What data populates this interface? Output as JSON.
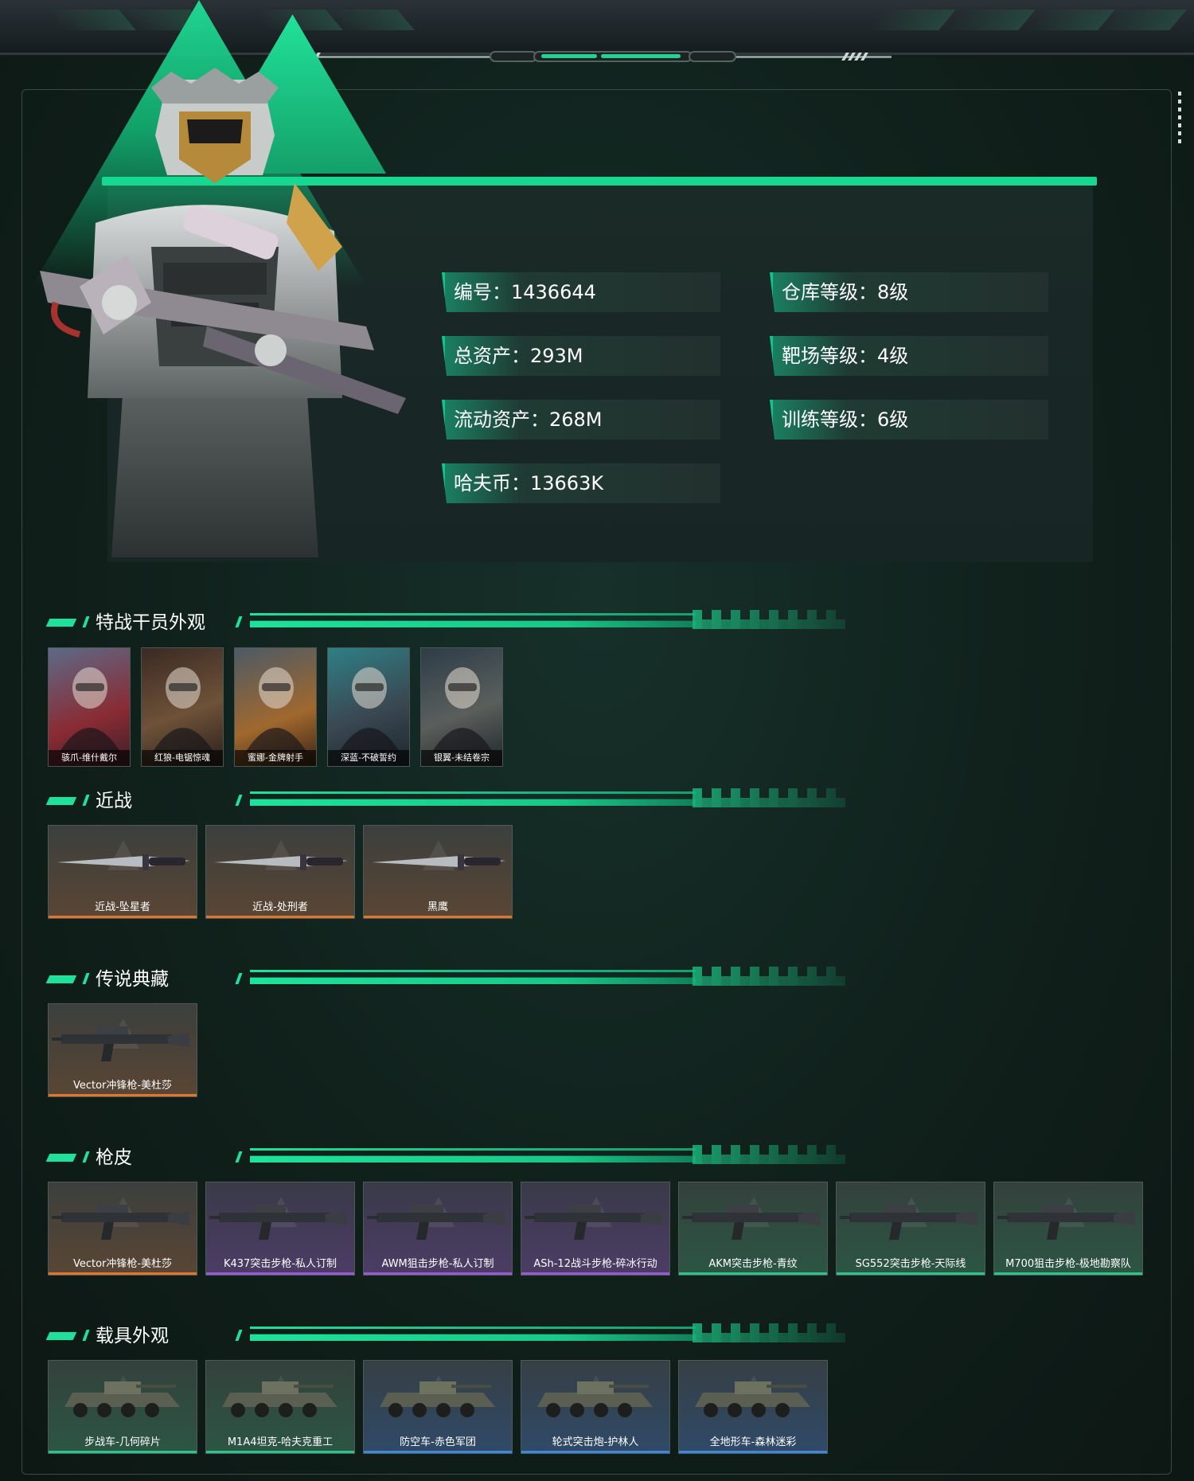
{
  "profile": {
    "id_label": "编号：1436644",
    "total_assets": "总资产：293M",
    "liquid_assets": "流动资产：268M",
    "hafu_coins": "哈夫币：13663K",
    "warehouse_level": "仓库等级：8级",
    "range_level": "靶场等级：4级",
    "training_level": "训练等级：6级"
  },
  "sections": {
    "operators": "特战干员外观",
    "melee": "近战",
    "legendary": "传说典藏",
    "skins": "枪皮",
    "vehicles": "载具外观"
  },
  "operators": [
    {
      "name": "骇爪-维什戴尔"
    },
    {
      "name": "红狼-电锯惊魂"
    },
    {
      "name": "蜜娜-金牌射手"
    },
    {
      "name": "深蓝-不破誓约"
    },
    {
      "name": "银翼-未结卷宗"
    }
  ],
  "melee": [
    {
      "name": "近战-坠星者",
      "rarity": "orange"
    },
    {
      "name": "近战-处刑者",
      "rarity": "orange"
    },
    {
      "name": "黑鹰",
      "rarity": "orange"
    }
  ],
  "legendary": [
    {
      "name": "Vector冲锋枪-美杜莎",
      "rarity": "orange"
    }
  ],
  "skins": [
    {
      "name": "Vector冲锋枪-美杜莎",
      "rarity": "orange"
    },
    {
      "name": "K437突击步枪-私人订制",
      "rarity": "purple"
    },
    {
      "name": "AWM狙击步枪-私人订制",
      "rarity": "purple"
    },
    {
      "name": "ASh-12战斗步枪-碎冰行动",
      "rarity": "purple"
    },
    {
      "name": "AKM突击步枪-青纹",
      "rarity": "green"
    },
    {
      "name": "SG552突击步枪-天际线",
      "rarity": "green"
    },
    {
      "name": "M700狙击步枪-极地勘察队",
      "rarity": "green"
    }
  ],
  "vehicles": [
    {
      "name": "步战车-几何碎片",
      "rarity": "green"
    },
    {
      "name": "M1A4坦克-哈夫克重工",
      "rarity": "green"
    },
    {
      "name": "防空车-赤色军团",
      "rarity": "blue"
    },
    {
      "name": "轮式突击炮-护林人",
      "rarity": "blue"
    },
    {
      "name": "全地形车-森林迷彩",
      "rarity": "blue"
    }
  ],
  "colors": {
    "accent": "#1ee29b",
    "orange": "#e0762e",
    "purple": "#9a5ad8",
    "green": "#2bc48a",
    "blue": "#3f86dc"
  },
  "icons": [
    "operator-portrait",
    "weapon-icon",
    "vehicle-icon",
    "warehouse-watermark-icon"
  ]
}
